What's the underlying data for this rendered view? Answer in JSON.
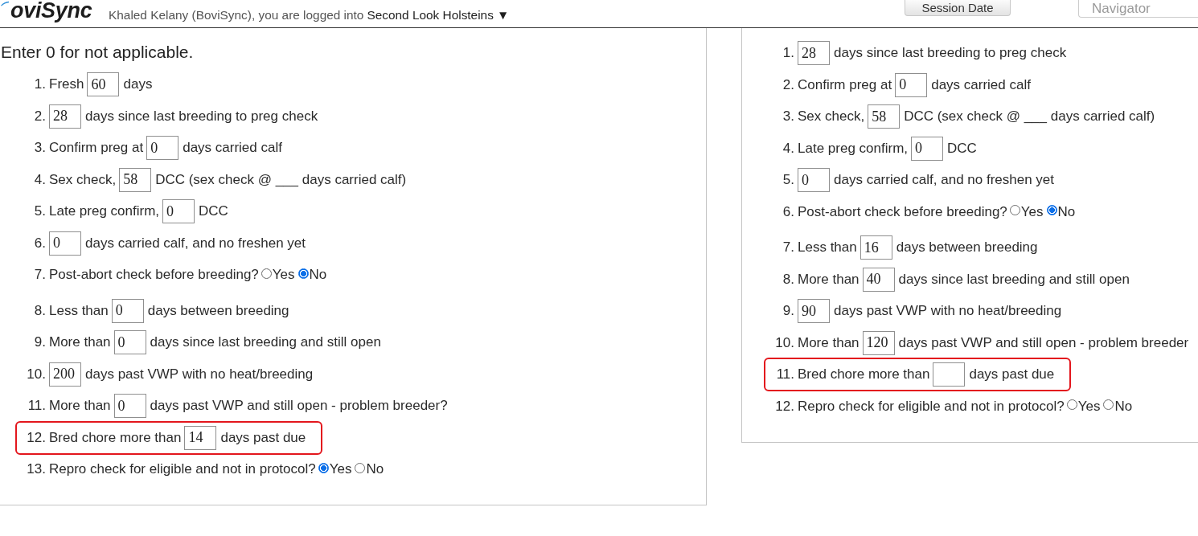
{
  "header": {
    "logo": "oviSync",
    "login_text": "Khaled Kelany (BoviSync), you are logged into",
    "farm": "Second Look Holsteins ▼",
    "session_button": "Session Date",
    "navigator": {
      "placeholder": "Navigator"
    }
  },
  "left_panel": {
    "note": "Enter 0 for not applicable.",
    "items": [
      {
        "number": "1.",
        "kind": "input",
        "label": "Fresh",
        "value": "60",
        "unit": "days",
        "highlighted": false
      },
      {
        "number": "2.",
        "kind": "input",
        "value": "28",
        "unit": "days since last breeding to preg check",
        "highlighted": false
      },
      {
        "number": "3.",
        "kind": "input",
        "label": "Confirm preg at",
        "value": "0",
        "unit": "days carried calf",
        "highlighted": false
      },
      {
        "number": "4.",
        "kind": "input",
        "label": "Sex check,",
        "value": "58",
        "unit": "DCC (sex check @ ___ days carried calf)",
        "highlighted": false
      },
      {
        "number": "5.",
        "kind": "input",
        "label": "Late preg confirm,",
        "value": "0",
        "unit": "DCC",
        "highlighted": false
      },
      {
        "number": "6.",
        "kind": "input",
        "value": "0",
        "unit": "days carried calf, and no freshen yet",
        "highlighted": false
      },
      {
        "number": "7.",
        "kind": "radio",
        "label": "Post-abort check before breeding?",
        "options": [
          {
            "label": "Yes",
            "selected": false
          },
          {
            "label": "No",
            "selected": true
          }
        ],
        "highlighted": false
      },
      {
        "number": "8.",
        "kind": "input",
        "label": "Less than",
        "value": "0",
        "unit": "days between breeding",
        "highlighted": false
      },
      {
        "number": "9.",
        "kind": "input",
        "label": "More than",
        "value": "0",
        "unit": "days since last breeding and still open",
        "highlighted": false
      },
      {
        "number": "10.",
        "kind": "input",
        "value": "200",
        "unit": "days past VWP with no heat/breeding",
        "highlighted": false
      },
      {
        "number": "11.",
        "kind": "input",
        "label": "More than",
        "value": "0",
        "unit": "days past VWP and still open - problem breeder?",
        "highlighted": false
      },
      {
        "number": "12.",
        "kind": "input",
        "label": "Bred chore more than",
        "value": "14",
        "unit": "days past due",
        "highlighted": true
      },
      {
        "number": "13.",
        "kind": "radio",
        "label": "Repro check for eligible and not in protocol?",
        "options": [
          {
            "label": "Yes",
            "selected": true
          },
          {
            "label": "No",
            "selected": false
          }
        ],
        "highlighted": false
      }
    ]
  },
  "right_panel": {
    "items": [
      {
        "number": "1.",
        "kind": "input",
        "value": "28",
        "unit": "days since last breeding to preg check",
        "highlighted": false
      },
      {
        "number": "2.",
        "kind": "input",
        "label": "Confirm preg at",
        "value": "0",
        "unit": "days carried calf",
        "highlighted": false
      },
      {
        "number": "3.",
        "kind": "input",
        "label": "Sex check,",
        "value": "58",
        "unit": "DCC (sex check @ ___ days carried calf)",
        "highlighted": false
      },
      {
        "number": "4.",
        "kind": "input",
        "label": "Late preg confirm,",
        "value": "0",
        "unit": "DCC",
        "highlighted": false
      },
      {
        "number": "5.",
        "kind": "input",
        "value": "0",
        "unit": "days carried calf, and no freshen yet",
        "highlighted": false
      },
      {
        "number": "6.",
        "kind": "radio",
        "label": "Post-abort check before breeding?",
        "options": [
          {
            "label": "Yes",
            "selected": false
          },
          {
            "label": "No",
            "selected": true
          }
        ],
        "highlighted": false
      },
      {
        "number": "7.",
        "kind": "input",
        "label": "Less than",
        "value": "16",
        "unit": "days between breeding",
        "highlighted": false
      },
      {
        "number": "8.",
        "kind": "input",
        "label": "More than",
        "value": "40",
        "unit": "days since last breeding and still open",
        "highlighted": false
      },
      {
        "number": "9.",
        "kind": "input",
        "value": "90",
        "unit": "days past VWP with no heat/breeding",
        "highlighted": false
      },
      {
        "number": "10.",
        "kind": "input",
        "label": "More than",
        "value": "120",
        "unit": "days past VWP and still open - problem breeder",
        "highlighted": false
      },
      {
        "number": "11.",
        "kind": "input",
        "label": "Bred chore more than",
        "unit": "days past due",
        "highlighted": true
      },
      {
        "number": "12.",
        "kind": "radio",
        "label": "Repro check for eligible and not in protocol?",
        "options": [
          {
            "label": "Yes",
            "selected": false
          },
          {
            "label": "No",
            "selected": false
          }
        ],
        "highlighted": false
      }
    ]
  }
}
